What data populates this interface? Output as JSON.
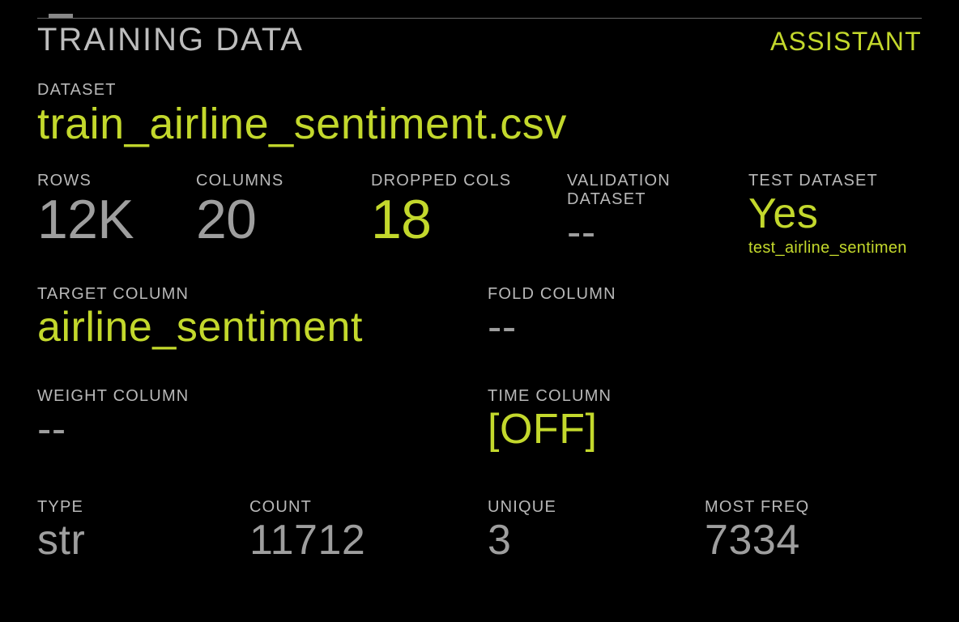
{
  "header": {
    "title": "TRAINING DATA",
    "assistant": "ASSISTANT"
  },
  "dataset": {
    "label": "DATASET",
    "value": "train_airline_sentiment.csv"
  },
  "stats_row": {
    "rows": {
      "label": "ROWS",
      "value": "12K"
    },
    "columns": {
      "label": "COLUMNS",
      "value": "20"
    },
    "dropped": {
      "label": "DROPPED COLS",
      "value": "18"
    },
    "validation": {
      "label": "VALIDATION DATASET",
      "value": "--"
    },
    "test": {
      "label": "TEST DATASET",
      "value": "Yes",
      "sub": "test_airline_sentimen"
    }
  },
  "target": {
    "label": "TARGET COLUMN",
    "value": "airline_sentiment"
  },
  "fold": {
    "label": "FOLD COLUMN",
    "value": "--"
  },
  "weight": {
    "label": "WEIGHT COLUMN",
    "value": "--"
  },
  "time": {
    "label": "TIME COLUMN",
    "value": "[OFF]"
  },
  "target_stats": {
    "type": {
      "label": "TYPE",
      "value": "str"
    },
    "count": {
      "label": "COUNT",
      "value": "11712"
    },
    "unique": {
      "label": "UNIQUE",
      "value": "3"
    },
    "mostfreq": {
      "label": "MOST FREQ",
      "value": "7334"
    }
  }
}
